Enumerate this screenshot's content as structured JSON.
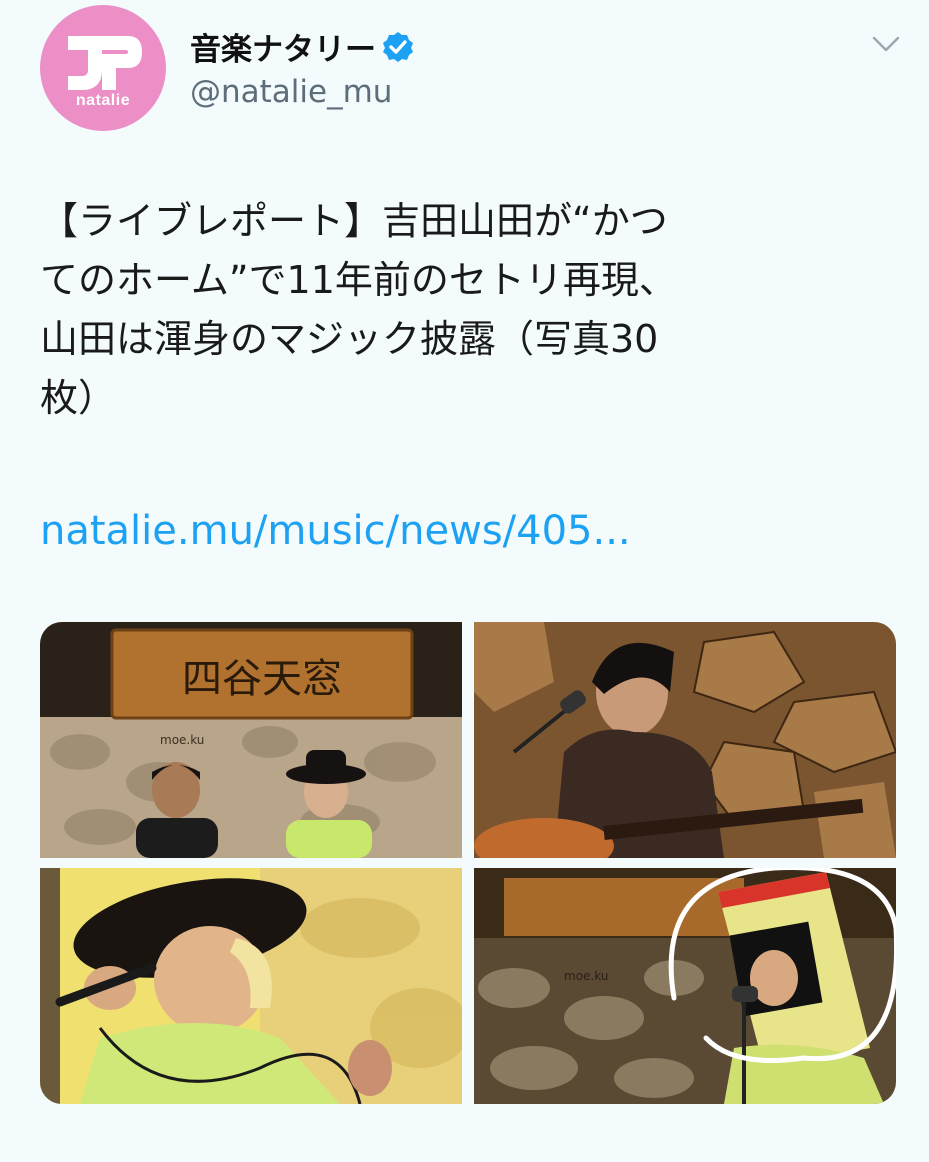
{
  "account": {
    "avatar_text": "natalie",
    "display_name": "音楽ナタリー",
    "handle": "@natalie_mu"
  },
  "tweet": {
    "lines": [
      "【ライブレポート】吉田山田が“かつ",
      "てのホーム”で11年前のセトリ再現、",
      "山田は渾身のマジック披露（写真30",
      "枚）"
    ],
    "link": "natalie.mu/music/news/405..."
  },
  "photos": {
    "sign_text": "四谷天窓",
    "wall_text": "moe.ku"
  },
  "colors": {
    "avatar_pink": "#ec8fc6",
    "verified_blue": "#1da1f2",
    "link_blue": "#1da1f2",
    "background": "#f3fbfd"
  },
  "icons": {
    "verified": "verified-badge-icon",
    "menu": "chevron-down-icon"
  }
}
